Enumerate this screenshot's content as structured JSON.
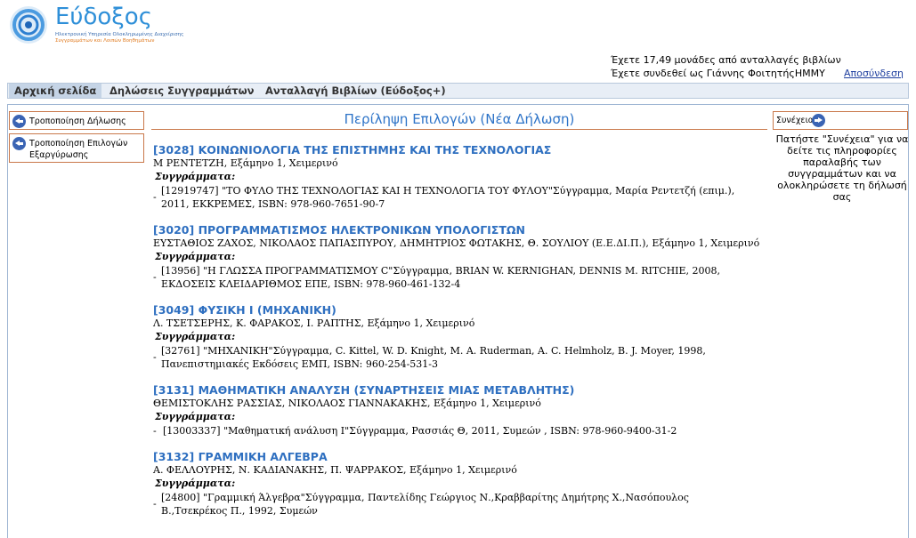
{
  "logo": {
    "title": "Εύδοξος",
    "subtitle_line1": "Ηλεκτρονική Υπηρεσία Ολοκληρωμένης Διαχείρισης",
    "subtitle_line2": "Συγγραμμάτων και Λοιπών Βοηθημάτων"
  },
  "user": {
    "credits_text": "Έχετε 17,49 μονάδες από ανταλλαγές βιβλίων",
    "logged_in_text": "Έχετε συνδεθεί ως Γιάννης ΦοιτητήςΗΜΜΥ",
    "logout_label": "Αποσύνδεση"
  },
  "nav": {
    "home": "Αρχική σελίδα",
    "declarations": "Δηλώσεις Συγγραμμάτων",
    "exchange": "Ανταλλαγή Βιβλίων (Εύδοξος+)"
  },
  "sidebar": {
    "modify_declaration": "Τροποποίηση Δήλωσης",
    "modify_redemption": "Τροποποίηση Επιλογών Εξαργύρωσης"
  },
  "main": {
    "title": "Περίληψη Επιλογών (Νέα Δήλωση)",
    "books_label": "Συγγράμματα:",
    "courses": [
      {
        "title": "[3028] ΚΟΙΝΩΝΙΟΛΟΓΙΑ ΤΗΣ ΕΠΙΣΤΗΜΗΣ ΚΑΙ ΤΗΣ ΤΕΧΝΟΛΟΓΙΑΣ",
        "meta": "Μ ΡΕΝΤΕΤΖΗ, Εξάμηνο 1, Χειμερινό",
        "book_line1": "[12919747] \"ΤΟ ΦΥΛΟ ΤΗΣ ΤΕΧΝΟΛΟΓΙΑΣ ΚΑΙ Η ΤΕΧΝΟΛΟΓΙΑ ΤΟΥ ΦΥΛΟΥ\"Σύγγραμμα, Μαρία Ρεντετζή (επιμ.),",
        "book_line2": "2011, ΕΚΚΡΕΜΕΣ, ISBN: 978-960-7651-90-7"
      },
      {
        "title": "[3020] ΠΡΟΓΡΑΜΜΑΤΙΣΜΟΣ ΗΛΕΚΤΡΟΝΙΚΩΝ ΥΠΟΛΟΓΙΣΤΩΝ",
        "meta": "ΕΥΣΤΑΘΙΟΣ ΖΑΧΟΣ, ΝΙΚΟΛΑΟΣ ΠΑΠΑΣΠΥΡΟΥ, ΔΗΜΗΤΡΙΟΣ ΦΩΤΑΚΗΣ, Θ. ΣΟΥΛΙΟΥ (Ε.Ε.ΔΙ.Π.), Εξάμηνο 1, Χειμερινό",
        "book_line1": "[13956] \"Η ΓΛΩΣΣΑ ΠΡΟΓΡΑΜΜΑΤΙΣΜΟΥ C\"Σύγγραμμα, BRIAN W. KERNIGHAN, DENNIS M. RITCHIE, 2008,",
        "book_line2": "ΕΚΔΟΣΕΙΣ ΚΛΕΙΔΑΡΙΘΜΟΣ ΕΠΕ, ISBN: 978-960-461-132-4"
      },
      {
        "title": "[3049] ΦΥΣΙΚΗ Ι (ΜΗΧΑΝΙΚΗ)",
        "meta": "Λ. ΤΣΕΤΣΕΡΗΣ, Κ. ΦΑΡΑΚΟΣ, Ι. ΡΑΠΤΗΣ, Εξάμηνο 1, Χειμερινό",
        "book_line1": "[32761] \"ΜΗΧΑΝΙΚΗ\"Σύγγραμμα, C. Kittel, W. D. Knight, M. A. Ruderman, A. C. Helmholz, B. J. Moyer, 1998,",
        "book_line2": "Πανεπιστημιακές Εκδόσεις ΕΜΠ, ISBN: 960-254-531-3"
      },
      {
        "title": "[3131] ΜΑΘΗΜΑΤΙΚΗ ΑΝΑΛΥΣΗ (ΣΥΝΑΡΤΗΣΕΙΣ ΜΙΑΣ ΜΕΤΑΒΛΗΤΗΣ)",
        "meta": "ΘΕΜΙΣΤΟΚΛΗΣ ΡΑΣΣΙΑΣ, ΝΙΚΟΛΑΟΣ ΓΙΑΝΝΑΚΑΚΗΣ, Εξάμηνο 1, Χειμερινό",
        "book_line1": "[13003337] \"Μαθηματική ανάλυση Ι\"Σύγγραμμα, Ρασσιάς Θ, 2011, Συμεών , ISBN: 978-960-9400-31-2",
        "book_line2": ""
      },
      {
        "title": "[3132] ΓΡΑΜΜΙΚΗ ΑΛΓΕΒΡΑ",
        "meta": "Α. ΦΕΛΛΟΥΡΗΣ, Ν. ΚΑΔΙΑΝΑΚΗΣ, Π. ΨΑΡΡΑΚΟΣ, Εξάμηνο 1, Χειμερινό",
        "book_line1": "[24800] \"Γραμμική Άλγεβρα\"Σύγγραμμα, Παντελίδης Γεώργιος Ν.,Κραββαρίτης Δημήτρης Χ.,Νασόπουλος",
        "book_line2": "Β.,Τσεκρέκος Π., 1992, Συμεών"
      }
    ]
  },
  "continue": {
    "label": "Συνέχεια",
    "note": "Πατήστε \"Συνέχεια\" για να δείτε τις πληροφορίες παραλαβής των συγγραμμάτων και να ολοκληρώσετε τη δήλωσή σας"
  }
}
